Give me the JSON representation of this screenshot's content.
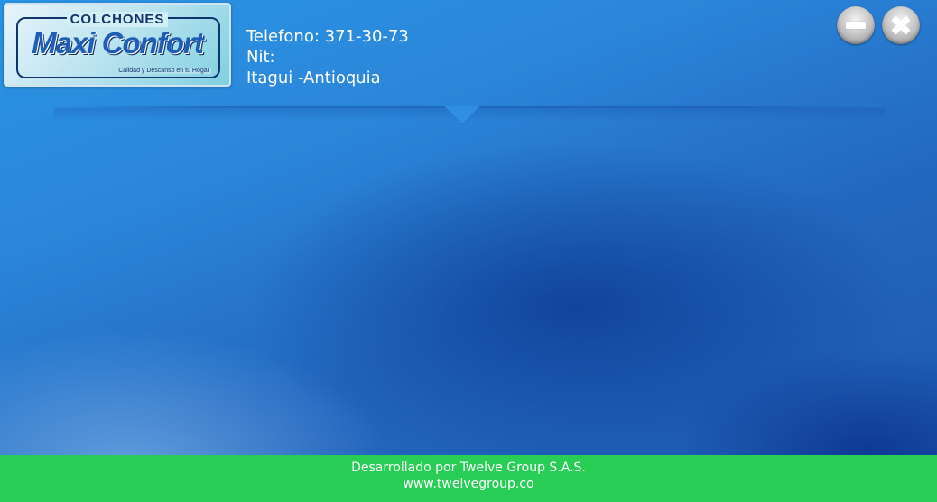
{
  "logo": {
    "top_text": "COLCHONES",
    "brand": "Maxi Confort",
    "tagline": "Calidad y Descanso en tu Hogar"
  },
  "company": {
    "phone": "Telefono: 371-30-73",
    "nit": "Nit:",
    "location": "Itagui -Antioquia"
  },
  "window_controls": {
    "minimize_icon": "minus-icon",
    "close_icon": "close-icon"
  },
  "footer": {
    "credit": "Desarrollado por Twelve Group S.A.S.",
    "website": "www.twelvegroup.co"
  },
  "colors": {
    "background": "#2b86d9",
    "footer": "#27cd55",
    "text": "#ffffff"
  }
}
